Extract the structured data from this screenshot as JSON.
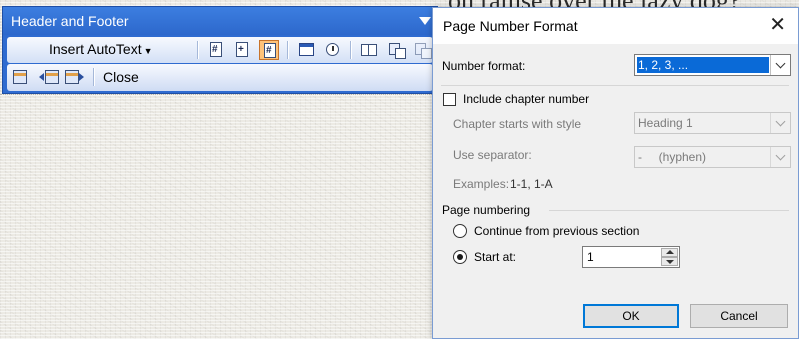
{
  "document": {
    "background_text": "on ramse over the lazy dog?"
  },
  "header_footer_toolbar": {
    "title": "Header and Footer",
    "insert_autotext_label": "Insert AutoText",
    "close_label": "Close"
  },
  "dialog": {
    "title": "Page Number Format",
    "number_format_label": "Number format:",
    "number_format_value": "1, 2, 3, ...",
    "include_chapter_label": "Include chapter number",
    "chapter_style_label": "Chapter starts with style",
    "chapter_style_value": "Heading 1",
    "separator_label": "Use separator:",
    "separator_value": "-     (hyphen)",
    "examples_label": "Examples:",
    "examples_value": "1-1, 1-A",
    "page_numbering_label": "Page numbering",
    "continue_label": "Continue from previous section",
    "start_at_label": "Start at:",
    "start_at_value": "1",
    "ok_label": "OK",
    "cancel_label": "Cancel"
  }
}
